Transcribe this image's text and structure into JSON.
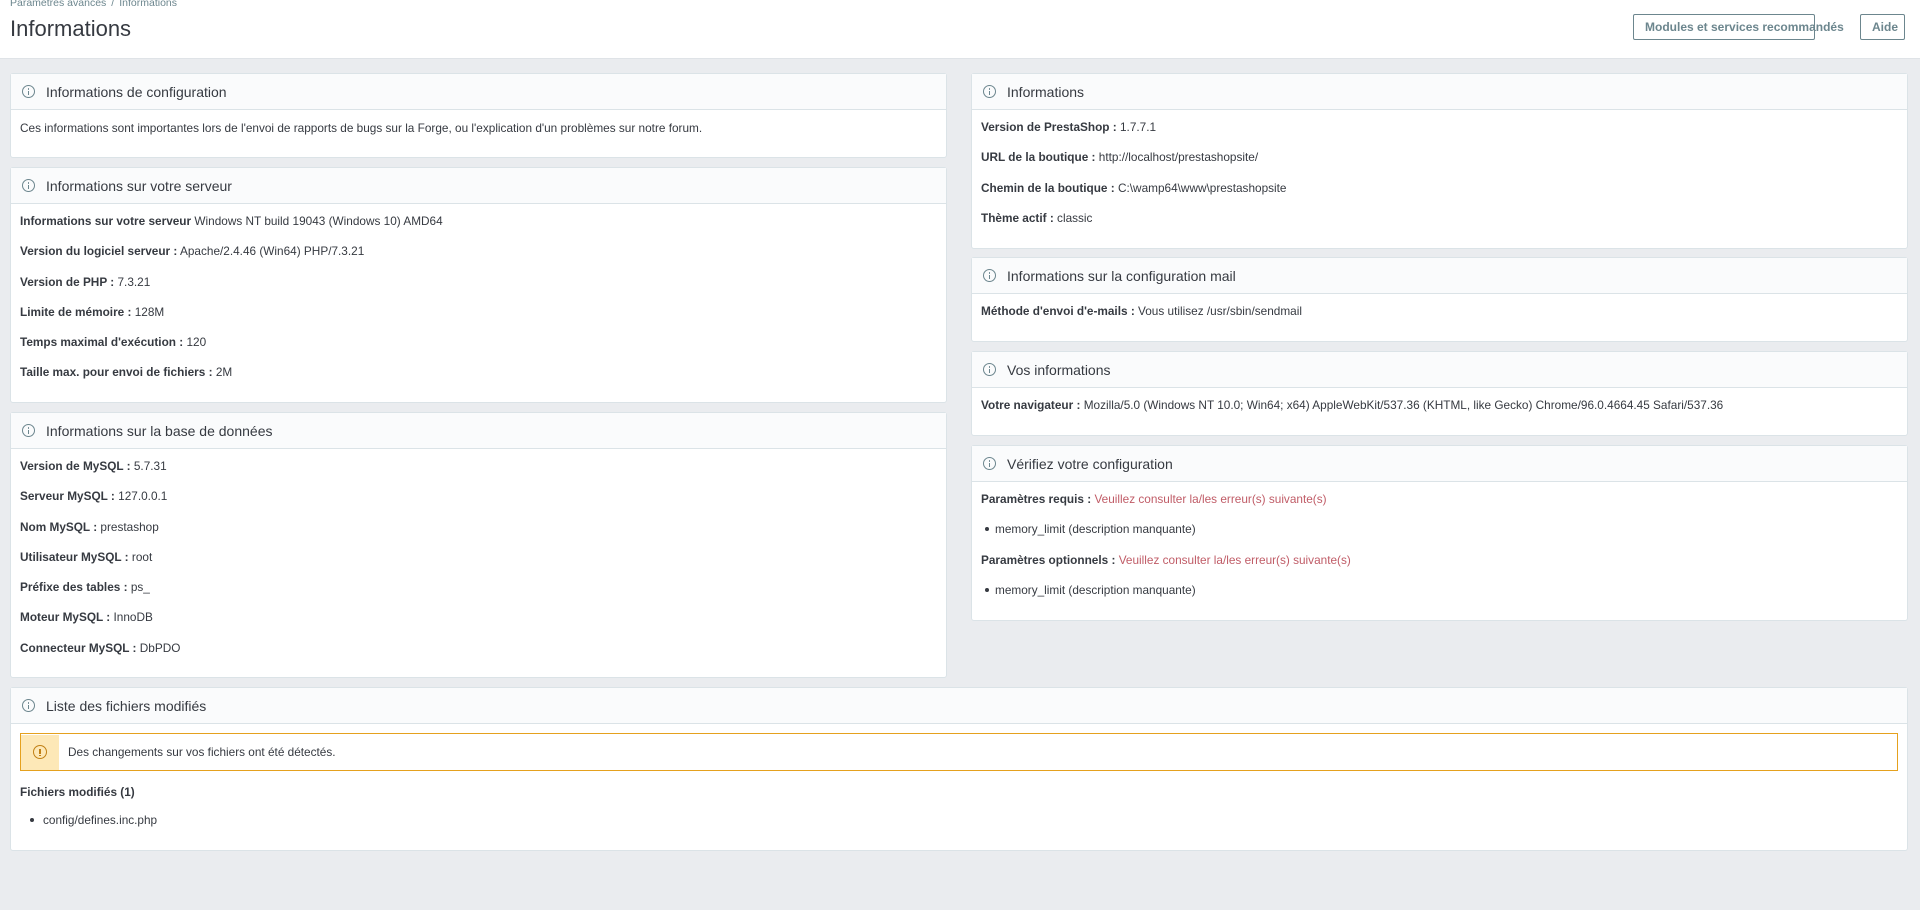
{
  "breadcrumb": {
    "parent": "Paramètres avancés",
    "separator": "/",
    "current": "Informations"
  },
  "page_title": "Informations",
  "header_buttons": {
    "recommended": "Modules et services recommandés",
    "help": "Aide"
  },
  "config_card": {
    "title": "Informations de configuration",
    "text": "Ces informations sont importantes lors de l'envoi de rapports de bugs sur la Forge, ou l'explication d'un problèmes sur notre forum."
  },
  "server_card": {
    "title": "Informations sur votre serveur",
    "rows": [
      {
        "label": "Informations sur votre serveur",
        "value": "Windows NT build 19043 (Windows 10) AMD64"
      },
      {
        "label": "Version du logiciel serveur :",
        "value": "Apache/2.4.46 (Win64) PHP/7.3.21"
      },
      {
        "label": "Version de PHP :",
        "value": "7.3.21"
      },
      {
        "label": "Limite de mémoire :",
        "value": "128M"
      },
      {
        "label": "Temps maximal d'exécution :",
        "value": "120"
      },
      {
        "label": "Taille max. pour envoi de fichiers :",
        "value": "2M"
      }
    ]
  },
  "db_card": {
    "title": "Informations sur la base de données",
    "rows": [
      {
        "label": "Version de MySQL :",
        "value": "5.7.31"
      },
      {
        "label": "Serveur MySQL :",
        "value": "127.0.0.1"
      },
      {
        "label": "Nom MySQL :",
        "value": "prestashop"
      },
      {
        "label": "Utilisateur MySQL :",
        "value": "root"
      },
      {
        "label": "Préfixe des tables :",
        "value": "ps_"
      },
      {
        "label": "Moteur MySQL :",
        "value": "InnoDB"
      },
      {
        "label": "Connecteur MySQL :",
        "value": "DbPDO"
      }
    ]
  },
  "info_card": {
    "title": "Informations",
    "rows": [
      {
        "label": "Version de PrestaShop :",
        "value": "1.7.7.1"
      },
      {
        "label": "URL de la boutique :",
        "value": "http://localhost/prestashopsite/"
      },
      {
        "label": "Chemin de la boutique :",
        "value": "C:\\wamp64\\www\\prestashopsite"
      },
      {
        "label": "Thème actif :",
        "value": "classic"
      }
    ]
  },
  "mail_card": {
    "title": "Informations sur la configuration mail",
    "rows": [
      {
        "label": "Méthode d'envoi d'e-mails :",
        "value": "Vous utilisez /usr/sbin/sendmail"
      }
    ]
  },
  "you_card": {
    "title": "Vos informations",
    "rows": [
      {
        "label": "Votre navigateur :",
        "value": "Mozilla/5.0 (Windows NT 10.0; Win64; x64) AppleWebKit/537.36 (KHTML, like Gecko) Chrome/96.0.4664.45 Safari/537.36"
      }
    ]
  },
  "check_card": {
    "title": "Vérifiez votre configuration",
    "required_label": "Paramètres requis :",
    "required_value": "Veuillez consulter la/les erreur(s) suivante(s)",
    "required_item": "memory_limit (description manquante)",
    "optional_label": "Paramètres optionnels :",
    "optional_value": "Veuillez consulter la/les erreur(s) suivante(s)",
    "optional_item": "memory_limit (description manquante)"
  },
  "files_card": {
    "title": "Liste des fichiers modifiés",
    "alert": "Des changements sur vos fichiers ont été détectés.",
    "modified_label": "Fichiers modifiés (1)",
    "files": [
      "config/defines.inc.php"
    ]
  },
  "colors": {
    "accent_error": "#c05c67",
    "warning_border": "#e5a11e",
    "page_bg": "#eaecef"
  }
}
